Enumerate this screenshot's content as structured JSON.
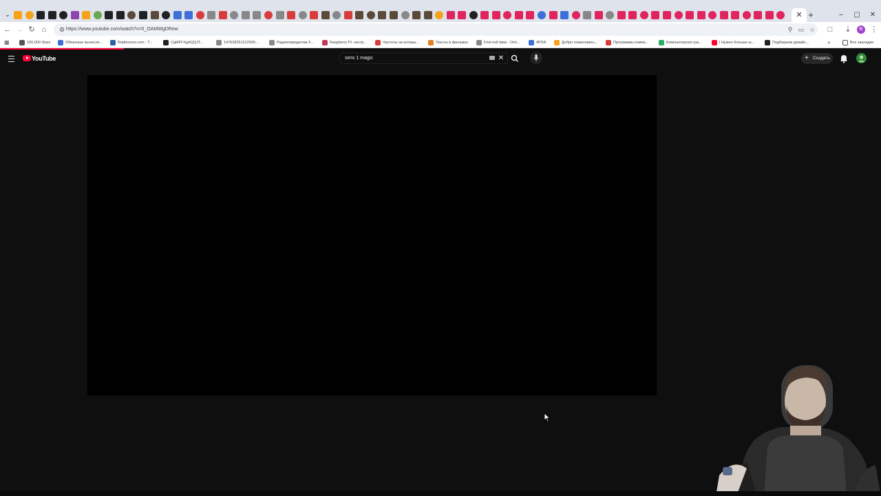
{
  "browser": {
    "url": "https://www.youtube.com/watch?v=0_OAMWgDRew",
    "profile_initial": "B",
    "window_controls": {
      "minimize": "–",
      "maximize": "▢",
      "close": "✕"
    },
    "new_tab": "+",
    "tab_close": "✕",
    "tab_list": "⌄",
    "tab_favicon_colors": [
      "#f6a21b",
      "#f6a21b",
      "#202124",
      "#202124",
      "#202124",
      "#8e44ad",
      "#f6a21b",
      "#6aa84f",
      "#202124",
      "#202124",
      "#5b4a3a",
      "#202124",
      "#5b4a3a",
      "#202124",
      "#3d6fd8",
      "#3d6fd8",
      "#d83d3d",
      "#888888",
      "#d83d3d",
      "#888888",
      "#888888",
      "#888888",
      "#d83d3d",
      "#888888",
      "#d83d3d",
      "#888888",
      "#d83d3d",
      "#5b4a3a",
      "#888888",
      "#d83d3d",
      "#5b4a3a",
      "#5b4a3a",
      "#5b4a3a",
      "#5b4a3a",
      "#888888",
      "#5b4a3a",
      "#5b4a3a",
      "#f6a21b",
      "#e0245e",
      "#e0245e",
      "#202124",
      "#e0245e",
      "#e0245e",
      "#e0245e",
      "#e0245e",
      "#e0245e",
      "#3d6fd8",
      "#e0245e",
      "#3d6fd8",
      "#e0245e",
      "#888888",
      "#e0245e",
      "#888888",
      "#e0245e",
      "#e0245e",
      "#e0245e",
      "#e0245e",
      "#e0245e",
      "#e0245e",
      "#e0245e",
      "#e0245e",
      "#e0245e",
      "#e0245e",
      "#e0245e",
      "#e0245e",
      "#e0245e",
      "#e0245e",
      "#e0245e"
    ]
  },
  "bookmarks": {
    "all_label": "Все закладки",
    "more": "»",
    "items": [
      {
        "label": "100,000 Stars",
        "color": "#555555"
      },
      {
        "label": "Облачные вычисле...",
        "color": "#3d6fd8"
      },
      {
        "label": "Radiooooo.com - T...",
        "color": "#2b5fa8"
      },
      {
        "label": "CgMFFXgAQQJT...",
        "color": "#202124"
      },
      {
        "label": "147628251312595...",
        "color": "#888888"
      },
      {
        "label": "Радиопередатчик F...",
        "color": "#888888"
      },
      {
        "label": "Raspberry Pi: настр...",
        "color": "#c0395a"
      },
      {
        "label": "Частоты на которы...",
        "color": "#d83d3d"
      },
      {
        "label": "Тексты в фильмах",
        "color": "#e67e22"
      },
      {
        "label": "Find exif data - Onli...",
        "color": "#888888"
      },
      {
        "label": "4PDA",
        "color": "#3d6fd8"
      },
      {
        "label": "Добро пожаловать...",
        "color": "#f6a21b"
      },
      {
        "label": "Программы компа...",
        "color": "#d83d3d"
      },
      {
        "label": "Компьютерная гра...",
        "color": "#27ae60"
      },
      {
        "label": "| Нужно больше ш...",
        "color": "#ff0033"
      },
      {
        "label": "Подбираем девайс...",
        "color": "#202124"
      }
    ]
  },
  "youtube": {
    "logo_text": "YouTube",
    "search": {
      "value": "sims 1 magic",
      "clear": "✕"
    },
    "create_label": "Создать",
    "create_plus": "+",
    "accent": "#ff0033"
  },
  "video": {
    "background": "#000000"
  }
}
